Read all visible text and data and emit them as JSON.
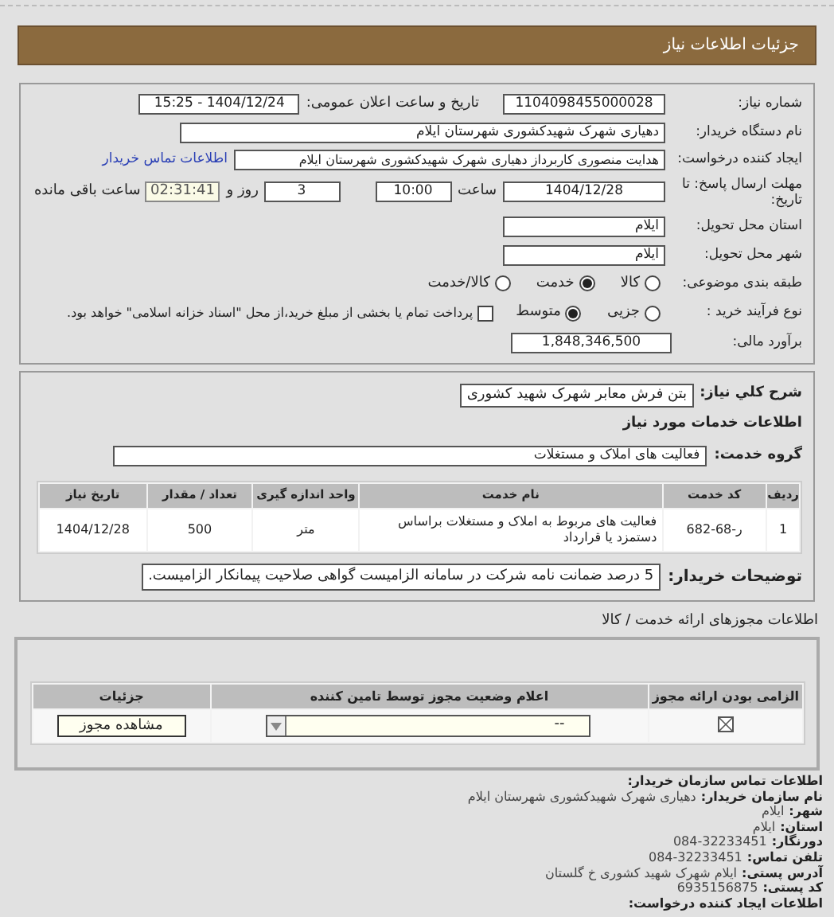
{
  "header": {
    "title": "جزئیات اطلاعات نیاز"
  },
  "need_number": {
    "label": "شماره نیاز:",
    "value": "1104098455000028"
  },
  "announce_datetime": {
    "label": "تاریخ و ساعت اعلان عمومی:",
    "value": "1404/12/24 - 15:25"
  },
  "buyer_org": {
    "label": "نام دستگاه خریدار:",
    "value": "دهیاری شهرک شهیدکشوری شهرستان ایلام"
  },
  "requester": {
    "label": "ایجاد کننده درخواست:",
    "value": "هدایت منصوری کاربرداز دهیاری شهرک شهیدکشوری شهرستان ایلام",
    "link": "اطلاعات تماس خریدار"
  },
  "deadline": {
    "label": "مهلت ارسال پاسخ: تا تاریخ:",
    "date": "1404/12/28",
    "time_label": "ساعت",
    "time": "10:00",
    "days": "3",
    "days_label": "روز و",
    "remaining": "02:31:41",
    "remaining_label": "ساعت باقی مانده"
  },
  "province": {
    "label": "استان محل تحویل:",
    "value": "ایلام"
  },
  "city": {
    "label": "شهر محل تحویل:",
    "value": "ایلام"
  },
  "category": {
    "label": "طبقه بندی موضوعی:",
    "options": [
      {
        "label": "کالا",
        "selected": false
      },
      {
        "label": "خدمت",
        "selected": true
      },
      {
        "label": "کالا/خدمت",
        "selected": false
      }
    ]
  },
  "process": {
    "label": "نوع فرآیند خرید :",
    "options": [
      {
        "label": "جزیی",
        "selected": false
      },
      {
        "label": "متوسط",
        "selected": true
      }
    ],
    "payment_option": {
      "label": "پرداخت تمام یا بخشی از مبلغ خرید،از محل \"اسناد خزانه اسلامی\" خواهد بود.",
      "checked": false
    }
  },
  "estimate": {
    "label": "برآورد مالی:",
    "value": "1,848,346,500"
  },
  "summary": {
    "label": "شرح کلي نياز:",
    "value": "بتن فرش معابر شهرک شهید کشوری"
  },
  "services_title": "اطلاعات خدمات مورد نیاز",
  "service_group": {
    "label": "گروه خدمت:",
    "value": "فعالیت های  املاک و مستغلات"
  },
  "services_table": {
    "columns": [
      "ردیف",
      "کد خدمت",
      "نام خدمت",
      "واحد اندازه گیری",
      "تعداد / مقدار",
      "تاریخ نیاز"
    ],
    "rows": [
      [
        "1",
        "ر-68-682",
        "فعالیت های مربوط به املاک و مستغلات براساس دستمزد یا قرارداد",
        "متر",
        "500",
        "1404/12/28"
      ]
    ]
  },
  "buyer_notes": {
    "label": "توضیحات خریدار:",
    "value": "5 درصد ضمانت نامه شرکت در سامانه الزامیست گواهی صلاحیت پیمانکار الزامیست."
  },
  "licenses": {
    "title": "اطلاعات مجوزهای ارائه خدمت / کالا",
    "columns": [
      "الزامی بودن ارائه مجوز",
      "اعلام وضعیت مجوز توسط تامین کننده",
      "جزئیات"
    ],
    "rows": [
      {
        "required": true,
        "status": "--",
        "action": "مشاهده مجوز"
      }
    ]
  },
  "contact": {
    "title": "اطلاعات تماس سازمان خریدار:",
    "lines": [
      {
        "label": "نام سازمان خریدار:",
        "value": "دهیاری شهرک شهیدکشوری شهرستان ایلام"
      },
      {
        "label": "شهر:",
        "value": "ایلام"
      },
      {
        "label": "استان:",
        "value": "ایلام"
      },
      {
        "label": "دورنگار:",
        "value": "084-32233451"
      },
      {
        "label": "تلفن تماس:",
        "value": "084-32233451"
      },
      {
        "label": "آدرس پستی:",
        "value": "ایلام شهرک شهید کشوری خ گلستان"
      },
      {
        "label": "کد پستی:",
        "value": "6935156875"
      }
    ],
    "footer": "اطلاعات ایجاد کننده درخواست:"
  }
}
